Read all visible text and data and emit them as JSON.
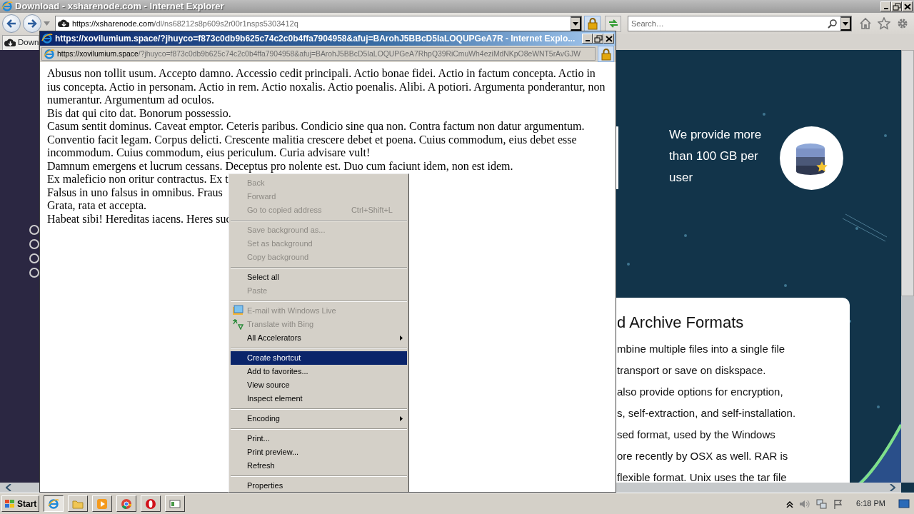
{
  "window": {
    "title": "Download - xsharenode.com - Internet Explorer"
  },
  "address_bar": {
    "url_host": "https://xsharenode.com",
    "url_path": "/dl/ns68212s8p609s2r00r1nsps5303412q"
  },
  "search": {
    "placeholder": "Search…"
  },
  "tabs": [
    {
      "label": "Down",
      "selected": true
    }
  ],
  "page": {
    "feature_text": "We provide more than 100 GB per user",
    "card": {
      "heading": "d Archive Formats",
      "lines": [
        "mbine multiple files into a single file",
        "transport or save on diskspace.",
        "also provide options for encryption,",
        "s, self-extraction, and self-installation.",
        "sed format, used by the Windows",
        "ore recently by OSX as well. RAR is",
        "flexible format. Unix uses the tar file"
      ]
    }
  },
  "popup": {
    "title": "https://xovilumium.space/?jhuyco=f873c0db9b625c74c2c0b4ffa7904958&afuj=BArohJ5BBcD5IaLOQUPGeA7R - Internet Explo...",
    "url_host": "https://xovilumium.space",
    "url_path": "/?jhuyco=f873c0db9b625c74c2c0b4ffa7904958&afuj=BArohJ5BBcD5IaLOQUPGeA7RhpQ39RiCmuWh4eziMdNKpO8eWNT5rAvGJW",
    "paragraphs": [
      "Abusus non tollit usum. Accepto damno. Accessio cedit principali. Actio bonae fidei. Actio in factum concepta. Actio in ius concepta. Actio in personam. Actio in rem. Actio noxalis. Actio poenalis. Alibi. A potiori. Argumenta ponderantur, non numerantur. Argumentum ad oculos.",
      "Bis dat qui cito dat. Bonorum possessio.",
      "Casum sentit dominus. Caveat emptor. Ceteris paribus. Condicio sine qua non. Contra factum non datur argumentum. Conventio facit legam. Corpus delicti. Crescente malitia crescere debet et poena. Cuius commodum, eius debet esse incommodum. Cuius commodum, eius periculum. Curia advisare vult!",
      "Damnum emergens et lucrum cessans. Deceptus pro nolente est. Duo cum faciunt idem, non est idem.",
      "Ex maleficio non oritur contractus. Ex t",
      "Falsus in uno falsus in omnibus. Fraus",
      "Grata, rata et accepta.",
      "Habeat sibi! Hereditas iacens. Heres suc"
    ]
  },
  "context_menu": {
    "items": [
      {
        "kind": "item",
        "label": "Back",
        "disabled": true,
        "selected": false,
        "submenu": false
      },
      {
        "kind": "item",
        "label": "Forward",
        "disabled": true,
        "selected": false,
        "submenu": false
      },
      {
        "kind": "item",
        "label": "Go to copied address",
        "shortcut": "Ctrl+Shift+L",
        "disabled": true,
        "selected": false,
        "submenu": false
      },
      {
        "kind": "separator"
      },
      {
        "kind": "item",
        "label": "Save background as...",
        "disabled": true,
        "selected": false,
        "submenu": false
      },
      {
        "kind": "item",
        "label": "Set as background",
        "disabled": true,
        "selected": false,
        "submenu": false
      },
      {
        "kind": "item",
        "label": "Copy background",
        "disabled": true,
        "selected": false,
        "submenu": false
      },
      {
        "kind": "separator"
      },
      {
        "kind": "item",
        "label": "Select all",
        "disabled": false,
        "selected": false,
        "submenu": false
      },
      {
        "kind": "item",
        "label": "Paste",
        "disabled": true,
        "selected": false,
        "submenu": false
      },
      {
        "kind": "separator"
      },
      {
        "kind": "accelerator",
        "label": "E-mail with Windows Live",
        "disabled": true,
        "selected": false,
        "submenu": false
      },
      {
        "kind": "accelerator",
        "label": "Translate with Bing",
        "disabled": true,
        "selected": false,
        "submenu": false
      },
      {
        "kind": "item",
        "label": "All Accelerators",
        "disabled": false,
        "selected": false,
        "submenu": true
      },
      {
        "kind": "separator"
      },
      {
        "kind": "item",
        "label": "Create shortcut",
        "disabled": false,
        "selected": true,
        "submenu": false
      },
      {
        "kind": "item",
        "label": "Add to favorites...",
        "disabled": false,
        "selected": false,
        "submenu": false
      },
      {
        "kind": "item",
        "label": "View source",
        "disabled": false,
        "selected": false,
        "submenu": false
      },
      {
        "kind": "item",
        "label": "Inspect element",
        "disabled": false,
        "selected": false,
        "submenu": false
      },
      {
        "kind": "separator"
      },
      {
        "kind": "item",
        "label": "Encoding",
        "disabled": false,
        "selected": false,
        "submenu": true
      },
      {
        "kind": "separator"
      },
      {
        "kind": "item",
        "label": "Print...",
        "disabled": false,
        "selected": false,
        "submenu": false
      },
      {
        "kind": "item",
        "label": "Print preview...",
        "disabled": false,
        "selected": false,
        "submenu": false
      },
      {
        "kind": "item",
        "label": "Refresh",
        "disabled": false,
        "selected": false,
        "submenu": false
      },
      {
        "kind": "separator"
      },
      {
        "kind": "item",
        "label": "Properties",
        "disabled": false,
        "selected": false,
        "submenu": false
      }
    ]
  },
  "taskbar": {
    "start": "Start",
    "clock": "6:18 PM"
  }
}
